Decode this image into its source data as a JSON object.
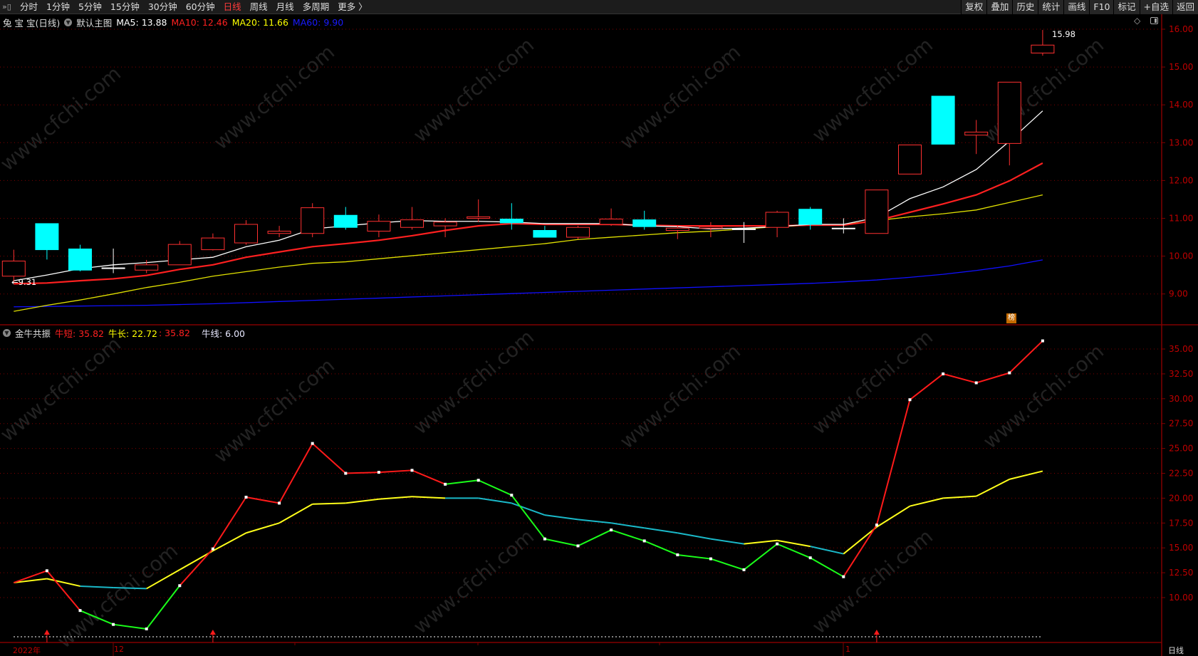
{
  "toolbar": {
    "tabs": [
      "分时",
      "1分钟",
      "5分钟",
      "15分钟",
      "30分钟",
      "60分钟",
      "日线",
      "周线",
      "月线",
      "多周期",
      "更多 〉"
    ],
    "active": "日线",
    "buttons": [
      "复权",
      "叠加",
      "历史",
      "统计",
      "画线",
      "F10",
      "标记",
      "+自选",
      "返回"
    ]
  },
  "main": {
    "title": "兔 宝 宝(日线)",
    "template": "默认主图",
    "ma": [
      {
        "label": "MA5: 13.88",
        "color": "#ffffff"
      },
      {
        "label": "MA10: 12.46",
        "color": "#ff2020"
      },
      {
        "label": "MA20: 11.66",
        "color": "#ffff00"
      },
      {
        "label": "MA60: 9.90",
        "color": "#1a1aff"
      }
    ],
    "low_label": "←9.31",
    "high_label": "15.98",
    "rank_badge": "榜",
    "axis": [
      "16.00",
      "15.00",
      "14.00",
      "13.00",
      "12.00",
      "11.00",
      "10.00",
      "9.00"
    ]
  },
  "indicator": {
    "name": "金牛共振",
    "short_label": "牛短: 35.82",
    "long_label": "牛长: 22.72",
    "extra_label": ": 35.82",
    "line_label": "牛线: 6.00",
    "axis": [
      "35.00",
      "32.50",
      "30.00",
      "27.50",
      "25.00",
      "22.50",
      "20.00",
      "17.50",
      "15.00",
      "12.50",
      "10.00"
    ]
  },
  "dates": {
    "labels": [
      "2022年",
      "12",
      "1"
    ],
    "period": "日线"
  },
  "watermark": "www.cfchi.com",
  "colors": {
    "up": "#ff3030",
    "down": "#00ffff",
    "ma5": "#ffffff",
    "ma10": "#ff2020",
    "ma20": "#e0e000",
    "ma60": "#1010ff",
    "grid": "#800000"
  },
  "chart_data": {
    "type": "candlestick",
    "candles": [
      [
        9.47,
        9.87,
        10.17,
        9.31
      ],
      [
        10.86,
        10.17,
        10.86,
        9.91
      ],
      [
        10.19,
        9.63,
        10.3,
        9.6
      ],
      [
        9.67,
        9.69,
        10.2,
        9.55
      ],
      [
        9.63,
        9.77,
        9.9,
        9.55
      ],
      [
        9.77,
        10.31,
        10.4,
        9.8
      ],
      [
        10.17,
        10.48,
        10.6,
        10.15
      ],
      [
        10.35,
        10.84,
        10.95,
        10.3
      ],
      [
        10.6,
        10.66,
        10.8,
        10.5
      ],
      [
        10.6,
        11.28,
        11.4,
        10.5
      ],
      [
        11.08,
        10.76,
        11.3,
        10.7
      ],
      [
        10.66,
        10.92,
        11.1,
        10.5
      ],
      [
        10.76,
        10.96,
        11.3,
        10.7
      ],
      [
        10.8,
        10.9,
        11.0,
        10.5
      ],
      [
        11.0,
        11.04,
        11.5,
        10.9
      ],
      [
        10.98,
        10.88,
        11.4,
        10.7
      ],
      [
        10.68,
        10.5,
        10.8,
        10.5
      ],
      [
        10.5,
        10.76,
        10.8,
        10.45
      ],
      [
        10.84,
        10.98,
        11.26,
        10.8
      ],
      [
        10.96,
        10.78,
        11.2,
        10.7
      ],
      [
        10.68,
        10.74,
        10.8,
        10.45
      ],
      [
        10.74,
        10.78,
        10.9,
        10.5
      ],
      [
        10.7,
        10.72,
        10.9,
        10.35
      ],
      [
        10.76,
        11.16,
        11.2,
        10.5
      ],
      [
        11.24,
        10.84,
        11.3,
        10.7
      ],
      [
        10.72,
        10.74,
        11.0,
        10.6
      ],
      [
        10.6,
        11.75,
        11.75,
        10.6
      ],
      [
        12.17,
        12.94,
        12.94,
        12.17
      ],
      [
        14.23,
        12.96,
        14.23,
        12.96
      ],
      [
        13.2,
        13.28,
        13.6,
        12.7
      ],
      [
        12.98,
        14.6,
        14.6,
        12.4
      ],
      [
        15.37,
        15.58,
        15.98,
        15.3
      ]
    ],
    "ma5": [
      9.35,
      9.5,
      9.67,
      9.77,
      9.83,
      9.9,
      9.97,
      10.25,
      10.42,
      10.72,
      10.8,
      10.88,
      10.94,
      10.92,
      10.92,
      10.9,
      10.86,
      10.86,
      10.86,
      10.8,
      10.78,
      10.72,
      10.74,
      10.78,
      10.84,
      10.84,
      11.02,
      11.52,
      11.83,
      12.29,
      13.04,
      13.84
    ],
    "ma10": [
      9.27,
      9.29,
      9.35,
      9.4,
      9.49,
      9.65,
      9.77,
      9.97,
      10.11,
      10.25,
      10.33,
      10.42,
      10.54,
      10.68,
      10.8,
      10.86,
      10.84,
      10.84,
      10.84,
      10.82,
      10.8,
      10.8,
      10.8,
      10.8,
      10.82,
      10.82,
      10.94,
      11.16,
      11.38,
      11.62,
      11.99,
      12.46
    ],
    "ma20": [
      8.54,
      8.7,
      8.84,
      9.0,
      9.17,
      9.31,
      9.47,
      9.59,
      9.71,
      9.81,
      9.85,
      9.93,
      10.01,
      10.09,
      10.17,
      10.25,
      10.33,
      10.44,
      10.5,
      10.56,
      10.62,
      10.66,
      10.72,
      10.78,
      10.82,
      10.84,
      10.94,
      11.04,
      11.12,
      11.22,
      11.42,
      11.62
    ],
    "ma60": [
      8.66,
      8.67,
      8.68,
      8.69,
      8.7,
      8.72,
      8.74,
      8.77,
      8.8,
      8.83,
      8.86,
      8.89,
      8.92,
      8.95,
      8.98,
      9.01,
      9.04,
      9.07,
      9.1,
      9.13,
      9.16,
      9.19,
      9.22,
      9.25,
      9.28,
      9.32,
      9.37,
      9.44,
      9.52,
      9.62,
      9.74,
      9.9
    ],
    "price_range": [
      8.3,
      16.3
    ],
    "short": [
      11.5,
      12.7,
      8.7,
      7.3,
      6.85,
      11.2,
      14.9,
      20.1,
      19.5,
      25.5,
      22.5,
      22.6,
      22.8,
      21.4,
      21.8,
      20.3,
      15.9,
      15.2,
      16.8,
      15.7,
      14.3,
      13.9,
      12.8,
      15.4,
      14.0,
      12.1,
      17.3,
      29.9,
      32.5,
      31.6,
      32.6,
      35.82
    ],
    "short_colors": "rrggg",
    "long": [
      11.5,
      11.9,
      11.15,
      11.0,
      10.9,
      12.8,
      14.7,
      16.5,
      17.5,
      19.4,
      19.5,
      19.9,
      20.15,
      20.0,
      20.0,
      19.5,
      18.3,
      17.85,
      17.5,
      17.0,
      16.5,
      15.9,
      15.4,
      15.75,
      15.15,
      14.4,
      17.1,
      19.2,
      20.0,
      20.2,
      21.9,
      22.72
    ],
    "short_segment_colors": [
      "red",
      "red",
      "green",
      "green",
      "green",
      "red",
      "red",
      "red",
      "red",
      "red",
      "red",
      "red",
      "red",
      "green",
      "green",
      "green",
      "green",
      "green",
      "green",
      "green",
      "green",
      "green",
      "green",
      "green",
      "green",
      "red",
      "red",
      "red",
      "red",
      "red",
      "red"
    ],
    "long_segment_colors": [
      "yellow",
      "yellow",
      "cyan",
      "cyan",
      "yellow",
      "yellow",
      "yellow",
      "yellow",
      "yellow",
      "yellow",
      "yellow",
      "yellow",
      "yellow",
      "cyan",
      "cyan",
      "cyan",
      "cyan",
      "cyan",
      "cyan",
      "cyan",
      "cyan",
      "cyan",
      "yellow",
      "yellow",
      "cyan",
      "yellow",
      "yellow",
      "yellow",
      "yellow",
      "yellow",
      "yellow"
    ],
    "signal_arrows_at": [
      1,
      6,
      26
    ],
    "indicator_range": [
      5,
      37
    ]
  }
}
